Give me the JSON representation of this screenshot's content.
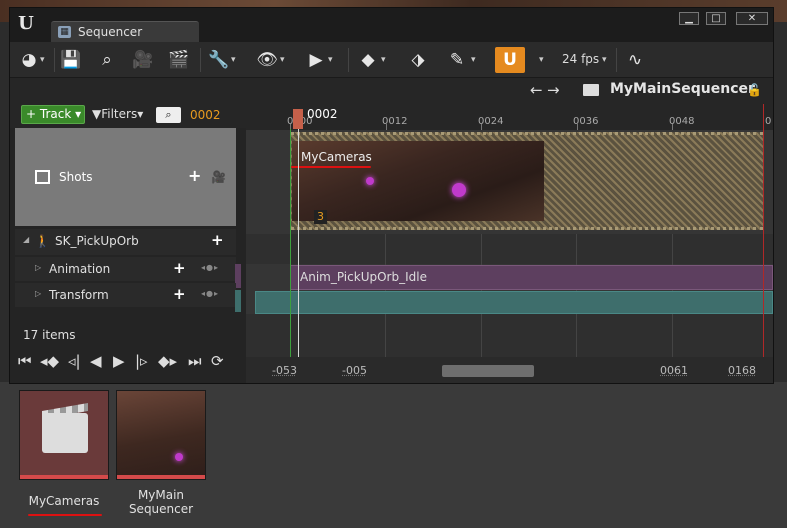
{
  "window": {
    "tab_title": "Sequencer",
    "buttons": {
      "minimize": "▁",
      "maximize": "□",
      "close": "✕"
    }
  },
  "toolbar": {
    "fps": "24 fps"
  },
  "nav": {
    "sequence_name": "MyMainSequencer"
  },
  "outliner": {
    "track_button": "Track",
    "filters_label": "Filters",
    "current_frame": "0002",
    "shots_label": "Shots",
    "rows": [
      {
        "label": "SK_PickUpOrb"
      },
      {
        "label": "Animation"
      },
      {
        "label": "Transform"
      }
    ],
    "items_count": "17 items"
  },
  "timeline": {
    "playhead_label": "0002",
    "ruler_labels": [
      "0000",
      "0012",
      "0024",
      "0036",
      "0048",
      "0"
    ],
    "shot": {
      "label": "MyCameras",
      "number": "3"
    },
    "anim_section_label": "Anim_PickUpOrb_Idle",
    "range": {
      "view_start": "-053",
      "working_start": "-005",
      "working_end": "0061",
      "view_end": "0168"
    }
  },
  "content_browser": {
    "assets": [
      {
        "label": "MyCameras"
      },
      {
        "label": "MyMain\nSequencer"
      }
    ]
  },
  "colors": {
    "accent_orange": "#e58a1f",
    "track_green": "#3a8a2a",
    "anim_purple": "#5d3f5f",
    "transform_teal": "#3e6e6c",
    "annotation_red": "#dd1111"
  }
}
